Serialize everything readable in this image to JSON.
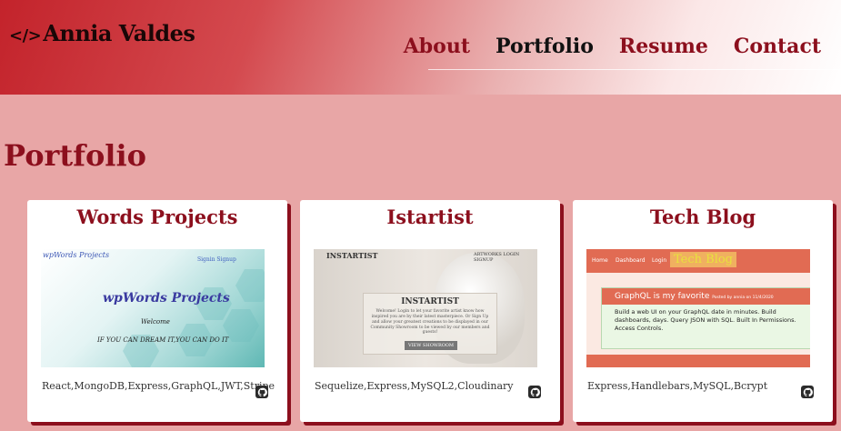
{
  "header": {
    "brand_code": "</>",
    "brand_name": "Annia Valdes",
    "nav": [
      {
        "label": "About",
        "active": false
      },
      {
        "label": "Portfolio",
        "active": true
      },
      {
        "label": "Resume",
        "active": false
      },
      {
        "label": "Contact",
        "active": false
      }
    ]
  },
  "page_title": "Portfolio",
  "colors": {
    "accent": "#8c0f1d",
    "background": "#e8a6a6",
    "header_start": "#c3232b"
  },
  "projects": [
    {
      "title": "Words Projects",
      "tech": "React,MongoDB,Express,GraphQL,JWT,Stripe",
      "link_icon": "github-icon",
      "screenshot": {
        "logo": "wpWords Projects",
        "links": "Signin   Signup",
        "heading": "wpWords Projects",
        "welcome": "Welcome",
        "quote": "IF YOU CAN DREAM IT,YOU CAN DO IT"
      }
    },
    {
      "title": "Istartist",
      "tech": "Sequelize,Express,MySQL2,Cloudinary",
      "link_icon": "github-icon",
      "screenshot": {
        "brand": "INSTARTIST",
        "links": "ARTWORKS   LOGIN   SIGNUP",
        "heading": "INSTARTIST",
        "text": "Welcome! Login to let your favorite artist know how inspired you are by their latest masterpiece. Or Sign Up and allow your greatest creations to be displayed in our Community Showroom to be viewed by our members and guests!",
        "button": "VIEW SHOWROOM"
      }
    },
    {
      "title": "Tech Blog",
      "tech": "Express,Handlebars,MySQL,Bcrypt",
      "link_icon": "github-icon",
      "screenshot": {
        "nav": [
          "Home",
          "Dashboard",
          "Login"
        ],
        "brand": "Tech Blog",
        "post_title": "GraphQL is my favorite",
        "post_meta": "Posted by annia on 11/4/2020",
        "post_body": "Build a web UI on your GraphQL date in minutes. Build dashboards, days. Query JSON with SQL. Built In Permissions. Access Controls."
      }
    }
  ]
}
